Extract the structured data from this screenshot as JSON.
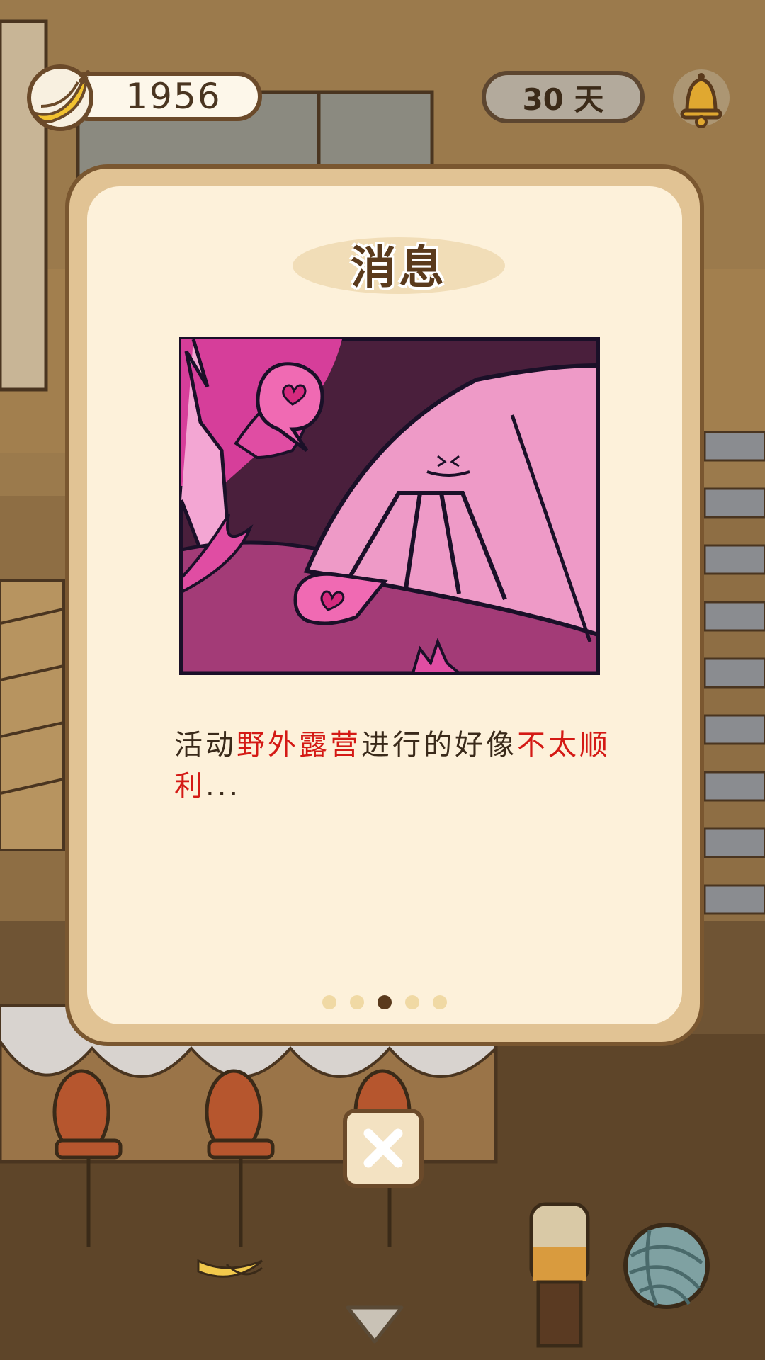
{
  "hud": {
    "banana_count": "1956",
    "days": "30 天"
  },
  "dialog": {
    "title": "消息",
    "message_parts": [
      {
        "text": "活动",
        "style": "normal"
      },
      {
        "text": "野外露营",
        "style": "highlight"
      },
      {
        "text": "进行的好像",
        "style": "normal"
      },
      {
        "text": "不太顺利",
        "style": "highlight"
      },
      {
        "text": "...",
        "style": "normal"
      }
    ],
    "pagination": {
      "total": 5,
      "current": 3
    }
  },
  "icons": {
    "banana": "banana-icon",
    "bell": "bell-icon",
    "close": "close-icon",
    "yarn": "yarn-ball-icon",
    "down_arrow": "down-arrow-icon"
  },
  "colors": {
    "highlight": "#d41a15",
    "card_border": "#7a5730",
    "card_bg": "#fdf1da",
    "dot_active": "#5a3a1c",
    "dot_inactive": "#f0d9a4"
  }
}
